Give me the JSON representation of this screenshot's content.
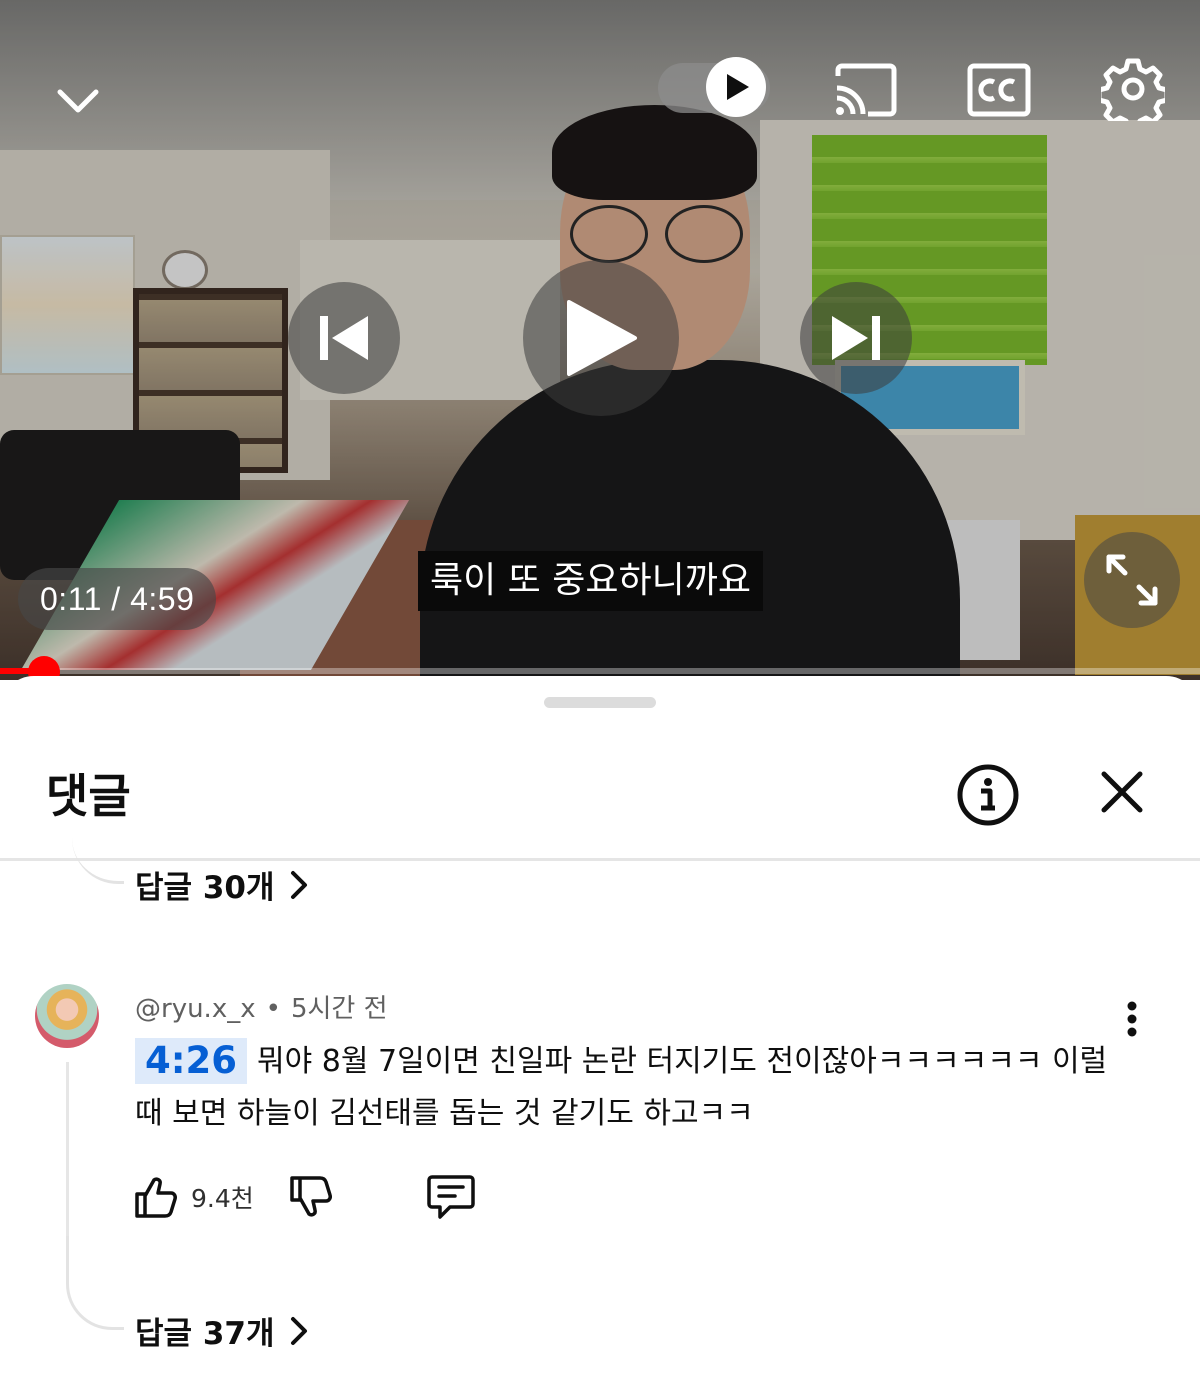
{
  "player": {
    "time_current": "0:11",
    "time_total": "4:59",
    "time_separator": "/",
    "subtitle": "룩이 또 중요하니까요",
    "progress_fraction": 0.037,
    "controls": {
      "collapse": "chevron-down-icon",
      "autoplay": "autoplay-toggle-icon",
      "cast": "cast-icon",
      "captions": "closed-captions-icon",
      "settings": "gear-icon",
      "previous": "skip-previous-icon",
      "play": "play-icon",
      "next": "skip-next-icon",
      "fullscreen": "fullscreen-icon"
    },
    "colors": {
      "progress": "#ff0000"
    }
  },
  "comments_panel": {
    "title": "댓글",
    "info_icon": "info-icon",
    "close_icon": "close-icon",
    "top_replies": {
      "label": "답글 30개"
    },
    "comment": {
      "author": "@ryu.x_x",
      "separator": "•",
      "time": "5시간 전",
      "timestamp_link": "4:26",
      "text": "뭐야 8월 7일이면 친일파 논란 터지기도 전이잖아ㅋㅋㅋㅋㅋㅋ 이럴 때 보면 하늘이 김선태를 돕는 것 같기도 하고ㅋㅋ",
      "likes": "9.4천",
      "replies_label": "답글 37개"
    },
    "colors": {
      "timestamp_bg": "#deeafa",
      "timestamp_text": "#065fd4"
    }
  }
}
